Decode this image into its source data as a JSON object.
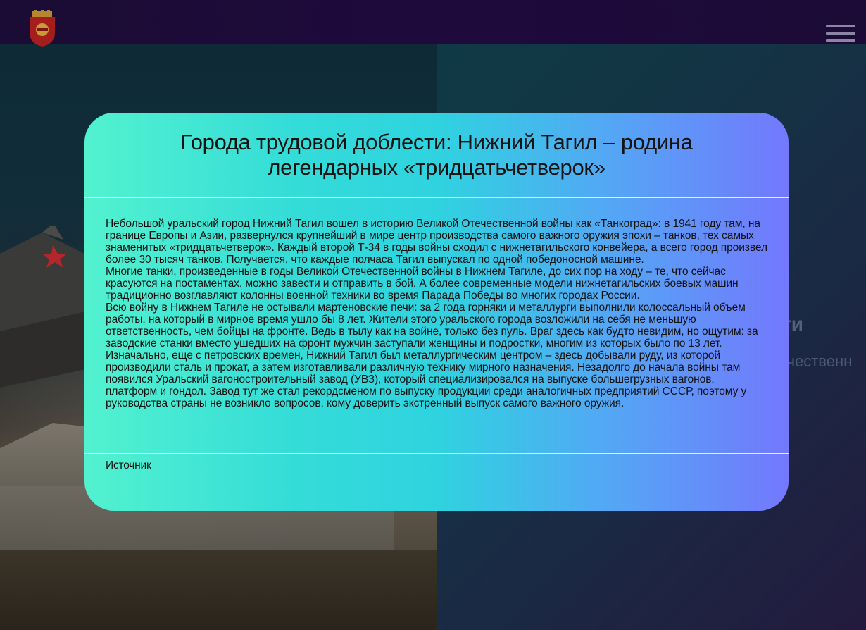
{
  "header": {
    "logo_icon": "city-emblem-icon",
    "menu_icon": "hamburger-menu-icon"
  },
  "background": {
    "title_fragment": "ти",
    "subtitle_fragment": "ечественн"
  },
  "modal": {
    "title": "Города трудовой доблести: Нижний Тагил – родина легендарных «тридцатьчетверок»",
    "paragraphs": [
      "Небольшой уральский город Нижний Тагил вошел в историю Великой Отечественной войны как «Танкоград»: в 1941 году там, на границе Европы и Азии, развернулся крупнейший в мире центр производства самого важного оружия эпохи – танков, тех самых знаменитых «тридцатьчетверок». Каждый второй Т-34 в годы войны сходил с нижнетагильского конвейера, а всего город произвел более 30 тысяч танков. Получается, что каждые полчаса Тагил выпускал по одной победоносной машине.",
      "Многие танки, произведенные в годы Великой Отечественной войны в Нижнем Тагиле, до сих пор на ходу – те, что сейчас красуются на постаментах, можно завести и отправить в бой. А более современные модели нижнетагильских боевых машин традиционно возглавляют колонны военной техники во время Парада Победы во многих городах России.",
      "Всю войну в Нижнем Тагиле не остывали мартеновские печи: за 2 года горняки и металлурги выполнили колоссальный объем работы, на который в мирное время ушло бы 8 лет. Жители этого уральского города возложили на себя не меньшую ответственность, чем бойцы на фронте. Ведь в тылу как на войне, только без пуль. Враг здесь как будто невидим, но ощутим: за заводские станки вместо ушедших на фронт мужчин заступали женщины и подростки, многим из которых было по 13 лет.",
      "Изначально, еще с петровских времен, Нижний Тагил был металлургическим центром – здесь добывали руду, из которой производили сталь и прокат, а затем изготавливали различную технику мирного назначения. Незадолго до начала войны там появился Уральский вагоностроительный завод (УВЗ), который специализировался на выпуске большегрузных вагонов, платформ и гондол. Завод тут же стал рекордсменом по выпуску продукции среди аналогичных предприятий СССР, поэтому у руководства страны не возникло вопросов, кому доверить экстренный выпуск самого важного оружия."
    ],
    "source_label": "Источник"
  }
}
